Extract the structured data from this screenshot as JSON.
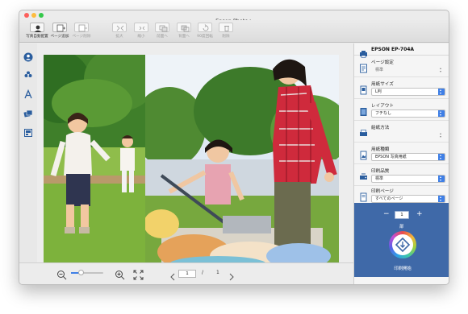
{
  "window": {
    "title": "Epson Photo+"
  },
  "toolbar": {
    "buttons": [
      {
        "label": "写真自動配置",
        "icon": "portrait-icon"
      },
      {
        "label": "ページ追加",
        "icon": "add-page-icon"
      },
      {
        "label": "ページ削除",
        "icon": "delete-page-icon"
      },
      {
        "label": "拡大",
        "icon": "enlarge-icon"
      },
      {
        "label": "縮小",
        "icon": "shrink-icon"
      },
      {
        "label": "前面へ",
        "icon": "bring-front-icon"
      },
      {
        "label": "背面へ",
        "icon": "send-back-icon"
      },
      {
        "label": "90度回転",
        "icon": "rotate-icon"
      },
      {
        "label": "削除",
        "icon": "trash-icon"
      }
    ]
  },
  "sidebar": {
    "icons": [
      "people-icon",
      "sticker-icon",
      "text-icon",
      "photos-icon",
      "layout-icon"
    ]
  },
  "right_panel": {
    "printer_name": "EPSON EP-704A",
    "settings": [
      {
        "label": "ページ設定",
        "value": "標準"
      },
      {
        "label": "用紙サイズ",
        "value": "L判"
      },
      {
        "label": "レイアウト",
        "value": "フチなし"
      },
      {
        "label": "給紙方法",
        "value": ""
      },
      {
        "label": "用紙種類",
        "value": "EPSON 写真用紙"
      },
      {
        "label": "印刷品質",
        "value": "標準"
      },
      {
        "label": "印刷ページ",
        "value": "すべてのページ"
      }
    ],
    "copies": {
      "minus": "−",
      "value": "1",
      "plus": "+",
      "unit": "部"
    },
    "print_label": "印刷開始"
  },
  "pagination": {
    "current": "1",
    "separator": "/",
    "total": "1"
  },
  "colors": {
    "accent": "#3f69a8",
    "select_arrow": "#3f7fe6"
  }
}
